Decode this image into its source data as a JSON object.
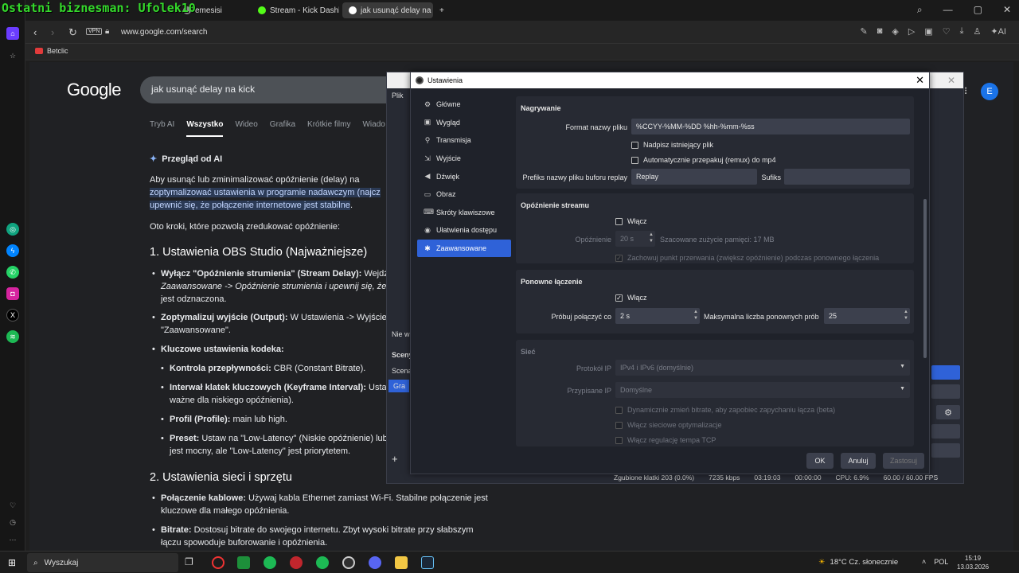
{
  "overlay": {
    "title": "Ostatni biznesman: Ufolek10"
  },
  "browser": {
    "tabs": [
      {
        "label": "emesisi",
        "active": false
      },
      {
        "label": "Stream - Kick Dashboard",
        "active": false
      },
      {
        "label": "jak usunąć delay na kick",
        "active": true
      }
    ],
    "new_tab": "+",
    "vpn": "VPN",
    "url": "www.google.com/search",
    "bookmark": "Betclic",
    "assistant": "AI"
  },
  "google": {
    "logo": "Google",
    "query": "jak usunąć delay na kick",
    "tabs": [
      "Tryb AI",
      "Wszystko",
      "Wideo",
      "Grafika",
      "Krótkie filmy",
      "Wiado"
    ],
    "active_tab": "Wszystko",
    "avatar": "E",
    "ai_overview": "Przegląd od AI",
    "intro_plain": "Aby usunąć lub zminimalizować opóźnienie (delay) na Kick.com,",
    "intro_hl1": "zoptymalizować ustawienia w programie nadawczym (najcz",
    "intro_hl2": "upewnić się, że połączenie internetowe jest stabilne",
    "intro_end": ".",
    "steps_intro": "Oto kroki, które pozwolą zredukować opóźnienie:",
    "h1": "1. Ustawienia OBS Studio (Najważniejsze)",
    "b1_bold": "Wyłącz \"Opóźnienie strumienia\" (Stream Delay):",
    "b1_rest": " Wejdź",
    "b1_line2": "Zaawansowane -> Opóźnienie strumienia i upewnij się, że c",
    "b1_line3": "jest odznaczona.",
    "b2_bold": "Zoptymalizuj wyjście (Output):",
    "b2_rest": " W Ustawienia -> Wyjście",
    "b2_line2": "\"Zaawansowane\".",
    "b3_bold": "Kluczowe ustawienia kodeka:",
    "s1_bold": "Kontrola przepływności:",
    "s1_rest": " CBR (Constant Bitrate).",
    "s2_bold": "Interwał klatek kluczowych (Keyframe Interval):",
    "s2_rest": " Usta",
    "s2_line2": "ważne dla niskiego opóźnienia).",
    "s3_bold": "Profil (Profile):",
    "s3_rest": " main lub high.",
    "s4_bold": "Preset:",
    "s4_rest": " Ustaw na \"Low-Latency\" (Niskie opóźnienie) lub",
    "s4_line2": "jest mocny, ale \"Low-Latency\" jest priorytetem.",
    "h2": "2. Ustawienia sieci i sprzętu",
    "b4_bold": "Połączenie kablowe:",
    "b4_rest": " Używaj kabla Ethernet zamiast Wi-Fi. Stabilne połączenie jest",
    "b4_line2": "kluczowe dla małego opóźnienia.",
    "b5_bold": "Bitrate:",
    "b5_rest": " Dostosuj bitrate do swojego internetu. Zbyt wysoki bitrate przy słabszym",
    "b5_line2": "łączu spowoduje buforowanie i opóźnienia."
  },
  "obs_main": {
    "menu": "Plik",
    "side_labels": [
      "Nie w",
      "Sceny",
      "Scena",
      "Gra"
    ],
    "status": {
      "dropped": "Zgubione klatki 203 (0.0%)",
      "bitrate": "7235 kbps",
      "live": "03:19:03",
      "rec": "00:00:00",
      "cpu": "CPU: 6.9%",
      "fps": "60.00 / 60.00 FPS"
    }
  },
  "settings": {
    "title": "Ustawienia",
    "nav": [
      {
        "label": "Główne",
        "icon": "gear-icon",
        "glyph": "⚙"
      },
      {
        "label": "Wygląd",
        "icon": "appearance-icon",
        "glyph": "▣"
      },
      {
        "label": "Transmisja",
        "icon": "broadcast-icon",
        "glyph": "⚲"
      },
      {
        "label": "Wyjście",
        "icon": "output-icon",
        "glyph": "⇲"
      },
      {
        "label": "Dźwięk",
        "icon": "audio-icon",
        "glyph": "◀"
      },
      {
        "label": "Obraz",
        "icon": "video-icon",
        "glyph": "▭"
      },
      {
        "label": "Skróty klawiszowe",
        "icon": "hotkeys-icon",
        "glyph": "⌨"
      },
      {
        "label": "Ułatwienia dostępu",
        "icon": "accessibility-icon",
        "glyph": "◉"
      },
      {
        "label": "Zaawansowane",
        "icon": "advanced-icon",
        "glyph": "✱"
      }
    ],
    "active_nav": "Zaawansowane",
    "recording": {
      "title": "Nagrywanie",
      "filename_label": "Format nazwy pliku",
      "filename_value": "%CCYY-%MM-%DD %hh-%mm-%ss",
      "overwrite": "Nadpisz istniejący plik",
      "remux": "Automatycznie przepakuj (remux) do mp4",
      "replay_prefix_label": "Prefiks nazwy pliku buforu replay",
      "replay_prefix_value": "Replay",
      "suffix_label": "Sufiks",
      "suffix_value": ""
    },
    "stream_delay": {
      "title": "Opóźnienie streamu",
      "enable": "Włącz",
      "enabled": false,
      "delay_label": "Opóźnienie",
      "delay_value": "20 s",
      "memory": "Szacowane zużycie pamięci: 17 MB",
      "preserve": "Zachowuj punkt przerwania (zwiększ opóźnienie) podczas ponownego łączenia",
      "preserve_checked": true
    },
    "reconnect": {
      "title": "Ponowne łączenie",
      "enable": "Włącz",
      "enabled": true,
      "retry_label": "Próbuj połączyć co",
      "retry_value": "2 s",
      "max_label": "Maksymalna liczba ponownych prób",
      "max_value": "25"
    },
    "network": {
      "title": "Sieć",
      "ip_label": "Protokół IP",
      "ip_value": "IPv4 i IPv6 (domyślnie)",
      "bind_label": "Przypisane IP",
      "bind_value": "Domyślne",
      "dyn_bitrate": "Dynamicznie zmień bitrate, aby zapobiec zapychaniu łącza (beta)",
      "net_opt": "Włącz sieciowe optymalizacje",
      "tcp_pacing": "Włącz regulację tempa TCP"
    },
    "buttons": {
      "ok": "OK",
      "cancel": "Anuluj",
      "apply": "Zastosuj"
    }
  },
  "taskbar": {
    "search": "Wyszukaj",
    "weather": "18°C  Cz. słonecznie",
    "lang": "POL",
    "time": "15:19",
    "date": "13.03.2026"
  }
}
